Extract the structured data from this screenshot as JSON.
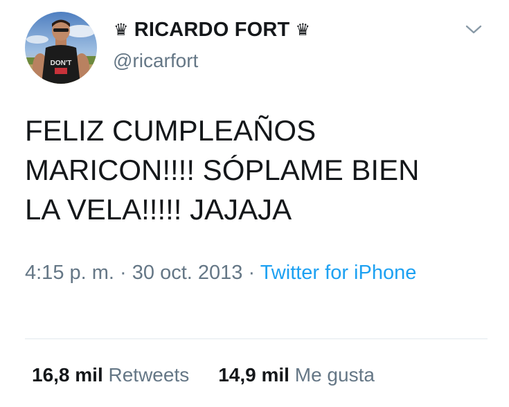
{
  "tweet": {
    "display_name": "RICARDO FORT",
    "crown_left": "♛",
    "crown_right": "♛",
    "handle": "@ricarfort",
    "avatar_shirt_text": "DON'T",
    "text": "FELIZ CUMPLEAÑOS\nMARICON!!!! SÓPLAME BIEN\nLA VELA!!!!! JAJAJA",
    "time": "4:15 p. m.",
    "separator": "·",
    "date": "30 oct. 2013",
    "source": "Twitter for iPhone",
    "retweets_count": "16,8 mil",
    "retweets_label": "Retweets",
    "likes_count": "14,9 mil",
    "likes_label": "Me gusta"
  },
  "icons": {
    "menu": "chevron-down-icon",
    "name_decoration": "crown-icon"
  },
  "colors": {
    "text": "#14171a",
    "secondary": "#657786",
    "link": "#1da1f2",
    "divider": "#e1e8ed"
  }
}
